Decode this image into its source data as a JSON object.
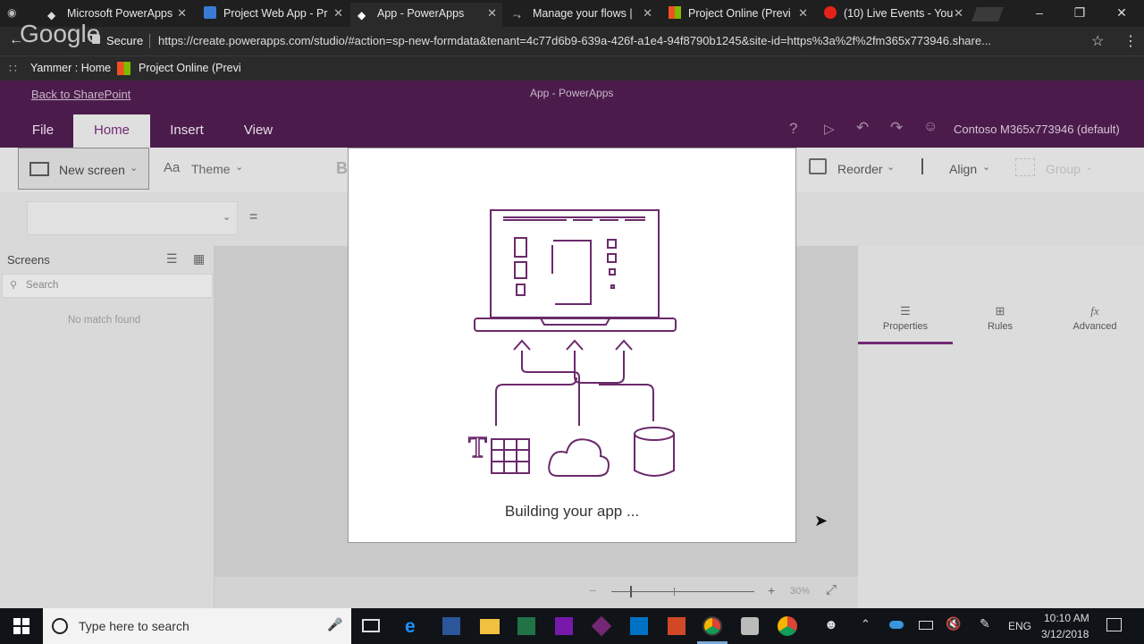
{
  "browser": {
    "tabs": [
      {
        "title": "Microsoft PowerApps",
        "icon": "powerapps-icon"
      },
      {
        "title": "Project Web App - Pr",
        "icon": "project-icon"
      },
      {
        "title": "App - PowerApps",
        "icon": "powerapps-icon"
      },
      {
        "title": "Manage your flows |",
        "icon": "flow-icon"
      },
      {
        "title": "Project Online (Previ",
        "icon": "windows-icon"
      },
      {
        "title": "(10) Live Events - You",
        "icon": "youtube-icon"
      }
    ],
    "close_glyph": "✕",
    "secure_label": "Secure",
    "url": "https://create.powerapps.com/studio/#action=sp-new-formdata&tenant=4c77d6b9-639a-426f-a1e4-94f8790b1245&site-id=https%3a%2f%2fm365x773946.share...",
    "google_logo": "Google",
    "bookmarks": [
      {
        "label": "Yammer : Home"
      },
      {
        "label": "Project Online (Previ"
      }
    ]
  },
  "app": {
    "back_link": "Back to SharePoint",
    "window_title": "App - PowerApps",
    "menu": [
      "File",
      "Home",
      "Insert",
      "View"
    ],
    "active_menu": "Home",
    "environment": "Contoso M365x773946 (default)",
    "ribbon": {
      "new_screen": "New screen",
      "theme": "Theme",
      "reorder": "Reorder",
      "align": "Align",
      "group": "Group",
      "partial_b": "B"
    },
    "formula": {
      "equals": "="
    },
    "left_panel": {
      "title": "Screens",
      "search_placeholder": "Search",
      "empty_text": "No match found"
    },
    "right_panel": {
      "tabs": [
        "Properties",
        "Rules",
        "Advanced"
      ],
      "fx": "fx"
    },
    "status": {
      "zoom": "30%",
      "minus": "−",
      "plus": "+"
    },
    "modal": {
      "message": "Building your app ..."
    }
  },
  "taskbar": {
    "search_placeholder": "Type here to search",
    "language": "ENG",
    "time": "10:10 AM",
    "date": "3/12/2018"
  },
  "colors": {
    "header": "#4b1c4b",
    "accent": "#742774",
    "illustration": "#6b2a6b"
  }
}
